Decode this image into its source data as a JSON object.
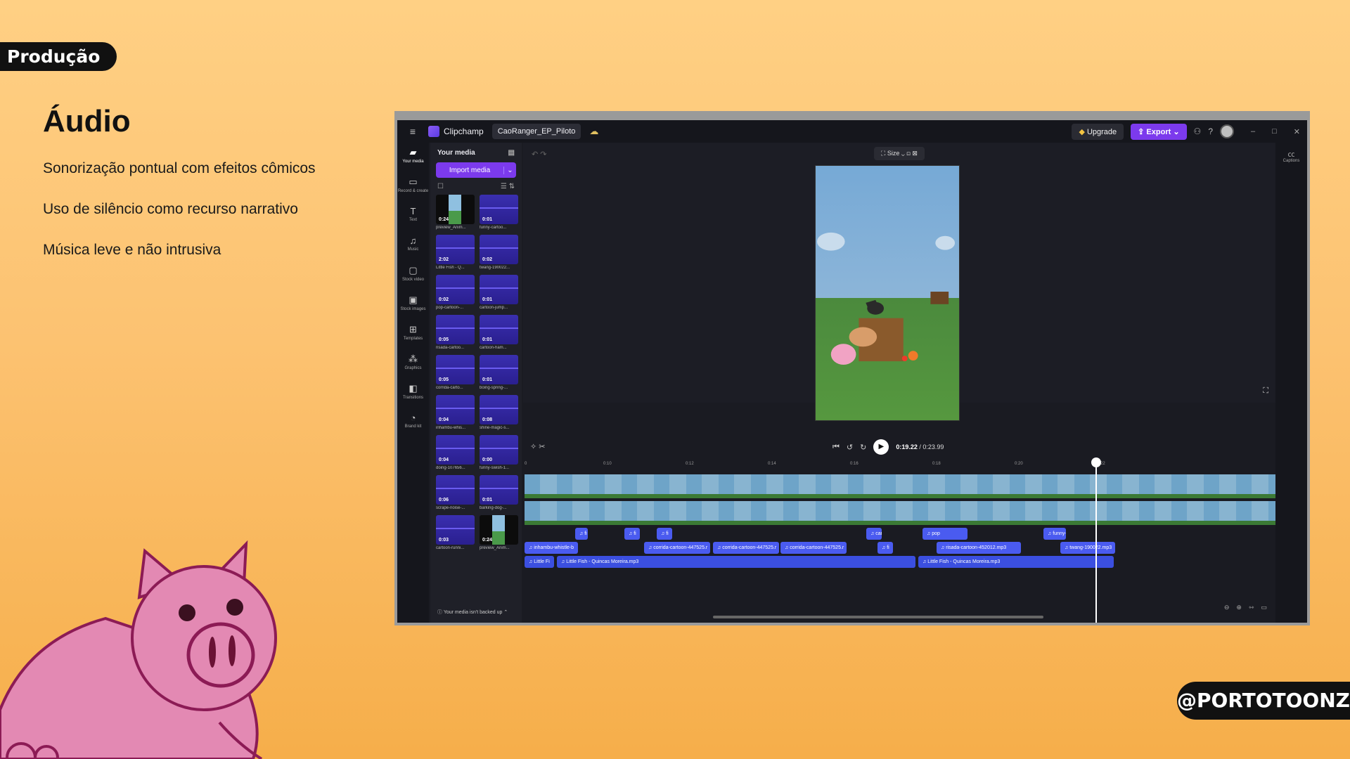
{
  "slide": {
    "section": "Produção",
    "title": "Áudio",
    "bullets": [
      "Sonorização pontual com efeitos cômicos",
      "Uso de silêncio como recurso narrativo",
      "Música leve e não intrusiva"
    ],
    "handle": "@PORTOTOONZ"
  },
  "app": {
    "name": "Clipchamp",
    "project": "CaoRanger_EP_Piloto",
    "upgrade": "Upgrade",
    "export": "Export",
    "captions": "Captions"
  },
  "nav": [
    {
      "label": "Your media",
      "icon": "folder-icon"
    },
    {
      "label": "Record & create",
      "icon": "camera-icon"
    },
    {
      "label": "Text",
      "icon": "text-icon"
    },
    {
      "label": "Music",
      "icon": "music-icon"
    },
    {
      "label": "Stock video",
      "icon": "stock-video-icon"
    },
    {
      "label": "Stock images",
      "icon": "image-icon"
    },
    {
      "label": "Templates",
      "icon": "templates-icon"
    },
    {
      "label": "Graphics",
      "icon": "graphics-icon"
    },
    {
      "label": "Transitions",
      "icon": "transitions-icon"
    },
    {
      "label": "Brand kit",
      "icon": "brand-icon"
    }
  ],
  "media": {
    "title": "Your media",
    "import": "Import media",
    "backup": "Your media isn't backed up",
    "items": [
      {
        "duration": "0:24",
        "name": "preview_Anim...",
        "video": true
      },
      {
        "duration": "0:01",
        "name": "funny-cartoo...",
        "video": false
      },
      {
        "duration": "2:02",
        "name": "Little Fish - Q...",
        "video": false
      },
      {
        "duration": "0:02",
        "name": "twang-190022...",
        "video": false
      },
      {
        "duration": "0:02",
        "name": "pop-cartoon-...",
        "video": false
      },
      {
        "duration": "0:01",
        "name": "cartoon-jump...",
        "video": false
      },
      {
        "duration": "0:05",
        "name": "risada-cartoo...",
        "video": false
      },
      {
        "duration": "0:01",
        "name": "cartoon-ham...",
        "video": false
      },
      {
        "duration": "0:05",
        "name": "corrida-carto...",
        "video": false
      },
      {
        "duration": "0:01",
        "name": "boing-spring-...",
        "video": false
      },
      {
        "duration": "0:04",
        "name": "inhambu-whis...",
        "video": false
      },
      {
        "duration": "0:08",
        "name": "shine-magic-s...",
        "video": false
      },
      {
        "duration": "0:04",
        "name": "doing-107656...",
        "video": false
      },
      {
        "duration": "0:00",
        "name": "funny-swish-1...",
        "video": false
      },
      {
        "duration": "0:06",
        "name": "scrape-noise-...",
        "video": false
      },
      {
        "duration": "0:01",
        "name": "barking-dog-...",
        "video": false
      },
      {
        "duration": "0:03",
        "name": "cartoon-runni...",
        "video": false
      },
      {
        "duration": "0:24",
        "name": "preview_Anim...",
        "video": true
      }
    ]
  },
  "editor": {
    "size_label": "Size",
    "time_current": "0:19.22",
    "time_total": "/ 0:23.99"
  },
  "timeline": {
    "ticks": [
      "0",
      "0:10",
      "0:12",
      "0:14",
      "0:16",
      "0:18",
      "0:20",
      "0:22"
    ],
    "row1": [
      "fi",
      "fi",
      "fi",
      "cartoon-hamm",
      "pop",
      "funny-cartoon"
    ],
    "row2": [
      "inhambu-whistle-b",
      "corrida-cartoon-447525.r",
      "corrida-cartoon-447525.r",
      "corrida-cartoon-447525.r",
      "fi",
      "risada-cartoon-452012.mp3",
      "twang-190022.mp3"
    ],
    "row3": [
      "Little Fi",
      "Little Fish - Quincas Moreira.mp3",
      "Little Fish - Quincas Moreira.mp3"
    ]
  }
}
